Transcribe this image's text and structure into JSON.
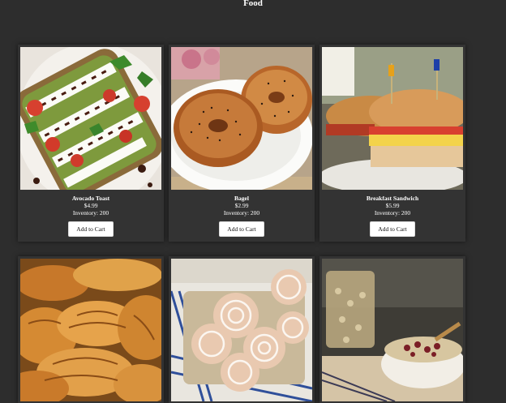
{
  "page": {
    "title": "Food"
  },
  "products": [
    {
      "name": "Avocado Toast",
      "price": "$4.99",
      "inventory": "Inventory: 200",
      "button": "Add to Cart",
      "image": "avocado-toast-photo"
    },
    {
      "name": "Bagel",
      "price": "$2.99",
      "inventory": "Inventory: 200",
      "button": "Add to Cart",
      "image": "bagel-photo"
    },
    {
      "name": "Breakfast Sandwich",
      "price": "$5.99",
      "inventory": "Inventory: 200",
      "button": "Add to Cart",
      "image": "breakfast-sandwich-photo"
    },
    {
      "image": "croissants-photo"
    },
    {
      "image": "cinnamon-rolls-photo"
    },
    {
      "image": "oatmeal-photo"
    }
  ]
}
